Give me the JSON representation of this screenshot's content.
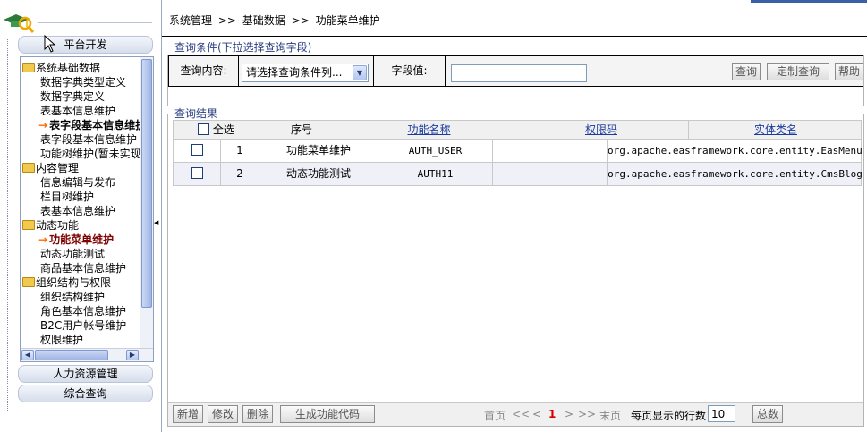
{
  "sidebar": {
    "accordion": {
      "platform_dev": "平台开发",
      "hr_mgmt": "人力资源管理",
      "general_query": "综合查询"
    },
    "tree": [
      {
        "type": "category",
        "label": "系统基础数据"
      },
      {
        "type": "leaf",
        "label": "数据字典类型定义"
      },
      {
        "type": "leaf",
        "label": "数据字典定义"
      },
      {
        "type": "leaf",
        "label": "表基本信息维护"
      },
      {
        "type": "current",
        "label": "表字段基本信息维护"
      },
      {
        "type": "leaf",
        "label": "表字段基本信息维护"
      },
      {
        "type": "leaf",
        "label": "功能树维护(暂未实现)"
      },
      {
        "type": "category",
        "label": "内容管理"
      },
      {
        "type": "leaf",
        "label": "信息编辑与发布"
      },
      {
        "type": "leaf",
        "label": "栏目树维护"
      },
      {
        "type": "leaf",
        "label": "表基本信息维护"
      },
      {
        "type": "category",
        "label": "动态功能"
      },
      {
        "type": "current-dark",
        "label": "功能菜单维护"
      },
      {
        "type": "leaf",
        "label": "动态功能测试"
      },
      {
        "type": "leaf",
        "label": "商品基本信息维护"
      },
      {
        "type": "category",
        "label": "组织结构与权限"
      },
      {
        "type": "leaf",
        "label": "组织结构维护"
      },
      {
        "type": "leaf",
        "label": "角色基本信息维护"
      },
      {
        "type": "leaf",
        "label": "B2C用户帐号维护"
      },
      {
        "type": "leaf",
        "label": "权限维护"
      }
    ]
  },
  "breadcrumb": {
    "part1": "系统管理",
    "sep": ">>",
    "part2": "基础数据",
    "part3": "功能菜单维护"
  },
  "query": {
    "legend": "查询条件(下拉选择查询字段)",
    "content_label": "查询内容:",
    "select_value": "请选择查询条件列...",
    "field_label": "字段值:",
    "field_value": "",
    "btn_query": "查询",
    "btn_custom": "定制查询",
    "btn_help": "帮助"
  },
  "results": {
    "legend": "查询结果",
    "select_all": "全选",
    "columns": [
      "序号",
      "功能名称",
      "权限码",
      "实体类名"
    ],
    "rows": [
      {
        "no": "1",
        "name": "功能菜单维护",
        "code": "AUTH_USER",
        "perm": "",
        "entity": "org.apache.easframework.core.entity.EasMenuList"
      },
      {
        "no": "2",
        "name": "动态功能测试",
        "code": "AUTH11",
        "perm": "",
        "entity": "org.apache.easframework.core.entity.CmsBlog"
      }
    ]
  },
  "footer": {
    "btn_add": "新增",
    "btn_edit": "修改",
    "btn_delete": "删除",
    "btn_gen": "生成功能代码",
    "first": "首页",
    "prev_fast": "<<",
    "prev": "<",
    "current_page": "1",
    "next": ">",
    "next_fast": ">>",
    "last": "末页",
    "rows_per_page_label": "每页显示的行数",
    "rows_per_page": "10",
    "total": "总数"
  },
  "colors": {
    "accent": "#2a3f80",
    "link": "#1a3aa0",
    "current_page": "#d40000",
    "arrow": "#ff6a00"
  }
}
